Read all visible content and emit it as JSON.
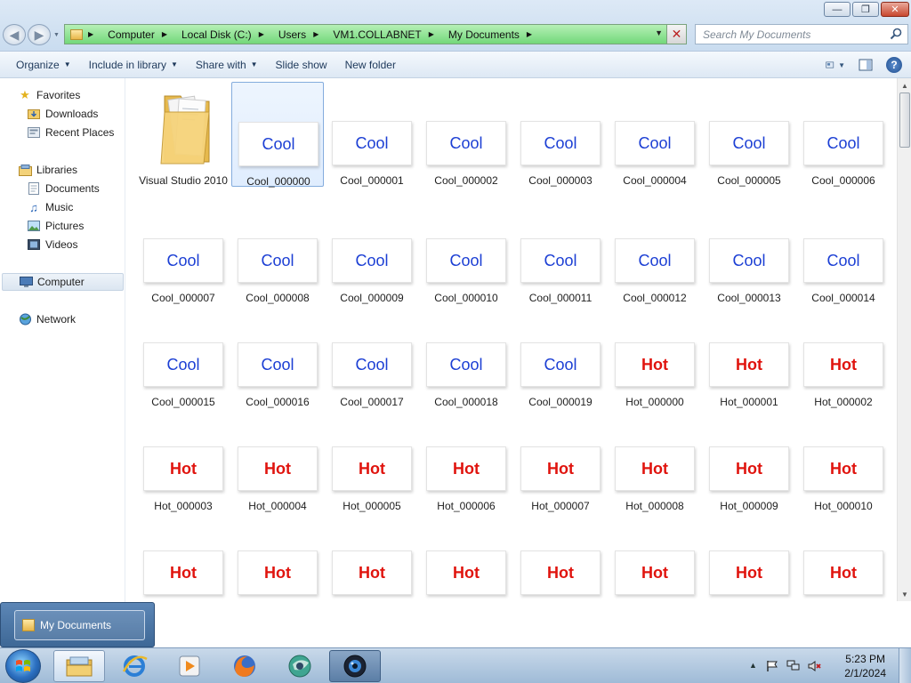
{
  "address": {
    "crumbs": [
      "Computer",
      "Local Disk (C:)",
      "Users",
      "VM1.COLLABNET",
      "My Documents"
    ]
  },
  "search": {
    "placeholder": "Search My Documents"
  },
  "toolbar": {
    "organize": "Organize",
    "include_in_library": "Include in library",
    "share_with": "Share with",
    "slide_show": "Slide show",
    "new_folder": "New folder"
  },
  "nav": {
    "favorites": "Favorites",
    "downloads": "Downloads",
    "recent_places": "Recent Places",
    "libraries": "Libraries",
    "documents": "Documents",
    "music": "Music",
    "pictures": "Pictures",
    "videos": "Videos",
    "computer": "Computer",
    "network": "Network"
  },
  "folder": {
    "label": "Visual Studio 2010"
  },
  "thumb_text": {
    "cool": "Cool",
    "hot": "Hot"
  },
  "files": [
    {
      "name": "Cool_000000",
      "kind": "cool"
    },
    {
      "name": "Cool_000001",
      "kind": "cool"
    },
    {
      "name": "Cool_000002",
      "kind": "cool"
    },
    {
      "name": "Cool_000003",
      "kind": "cool"
    },
    {
      "name": "Cool_000004",
      "kind": "cool"
    },
    {
      "name": "Cool_000005",
      "kind": "cool"
    },
    {
      "name": "Cool_000006",
      "kind": "cool"
    },
    {
      "name": "Cool_000007",
      "kind": "cool"
    },
    {
      "name": "Cool_000008",
      "kind": "cool"
    },
    {
      "name": "Cool_000009",
      "kind": "cool"
    },
    {
      "name": "Cool_000010",
      "kind": "cool"
    },
    {
      "name": "Cool_000011",
      "kind": "cool"
    },
    {
      "name": "Cool_000012",
      "kind": "cool"
    },
    {
      "name": "Cool_000013",
      "kind": "cool"
    },
    {
      "name": "Cool_000014",
      "kind": "cool"
    },
    {
      "name": "Cool_000015",
      "kind": "cool"
    },
    {
      "name": "Cool_000016",
      "kind": "cool"
    },
    {
      "name": "Cool_000017",
      "kind": "cool"
    },
    {
      "name": "Cool_000018",
      "kind": "cool"
    },
    {
      "name": "Cool_000019",
      "kind": "cool"
    },
    {
      "name": "Hot_000000",
      "kind": "hot"
    },
    {
      "name": "Hot_000001",
      "kind": "hot"
    },
    {
      "name": "Hot_000002",
      "kind": "hot"
    },
    {
      "name": "Hot_000003",
      "kind": "hot"
    },
    {
      "name": "Hot_000004",
      "kind": "hot"
    },
    {
      "name": "Hot_000005",
      "kind": "hot"
    },
    {
      "name": "Hot_000006",
      "kind": "hot"
    },
    {
      "name": "Hot_000007",
      "kind": "hot"
    },
    {
      "name": "Hot_000008",
      "kind": "hot"
    },
    {
      "name": "Hot_000009",
      "kind": "hot"
    },
    {
      "name": "Hot_000010",
      "kind": "hot"
    },
    {
      "name": "",
      "kind": "hot"
    },
    {
      "name": "",
      "kind": "hot"
    },
    {
      "name": "",
      "kind": "hot"
    },
    {
      "name": "",
      "kind": "hot"
    },
    {
      "name": "",
      "kind": "hot"
    },
    {
      "name": "",
      "kind": "hot"
    },
    {
      "name": "",
      "kind": "hot"
    },
    {
      "name": "",
      "kind": "hot"
    }
  ],
  "selected_file": "Cool_000000",
  "taskbar": {
    "popup_label": "My Documents",
    "time": "5:23 PM",
    "date": "2/1/2024"
  },
  "colors": {
    "cool_text": "#1c3fd4",
    "hot_text": "#e0140e",
    "address_bar": "#72d87a"
  }
}
